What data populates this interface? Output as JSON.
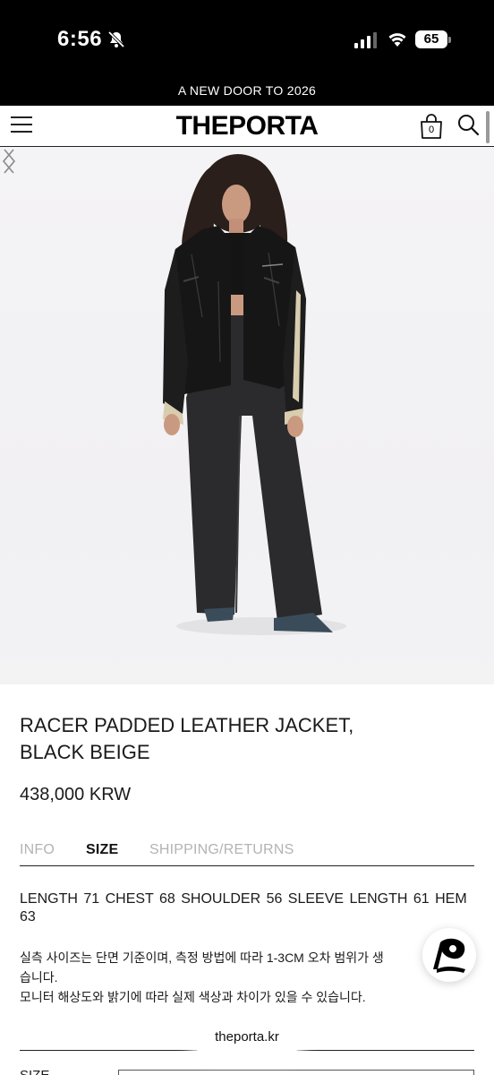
{
  "status_bar": {
    "time": "6:56",
    "battery": "65"
  },
  "announcement": "A NEW DOOR TO 2026",
  "header": {
    "logo": "THEPORTA",
    "cart_count": "0"
  },
  "product": {
    "title_line1": "RACER PADDED LEATHER JACKET,",
    "title_line2": "BLACK BEIGE",
    "price": "438,000 KRW"
  },
  "tabs": [
    {
      "label": "INFO",
      "active": false
    },
    {
      "label": "SIZE",
      "active": true
    },
    {
      "label": "SHIPPING/RETURNS",
      "active": false
    }
  ],
  "size_info": {
    "measurements": "LENGTH 71  CHEST 68  SHOULDER 56  SLEEVE LENGTH 61  HEM 63",
    "note_line1": "실측 사이즈는 단면 기준이며, 측정 방법에 따라 1-3CM 오차 범위가 생",
    "note_line2": "습니다.",
    "note_line3": "모니터 해상도와 밝기에 따라 실제 색상과 차이가 있을 수 있습니다."
  },
  "option": {
    "label": "SIZE"
  },
  "browser": {
    "url": "theporta.kr"
  },
  "icons": [
    "bell-slash-icon",
    "signal-icon",
    "wifi-icon",
    "battery-icon",
    "menu-icon",
    "shopping-bag-icon",
    "search-icon",
    "chevron-left-icon",
    "chevron-right-icon",
    "app-logo-icon"
  ],
  "colors": {
    "bar_background": "#000000",
    "accent": "#111111",
    "inactive_tab": "#b3b3b3",
    "hero_background": "#f3f2f4"
  }
}
